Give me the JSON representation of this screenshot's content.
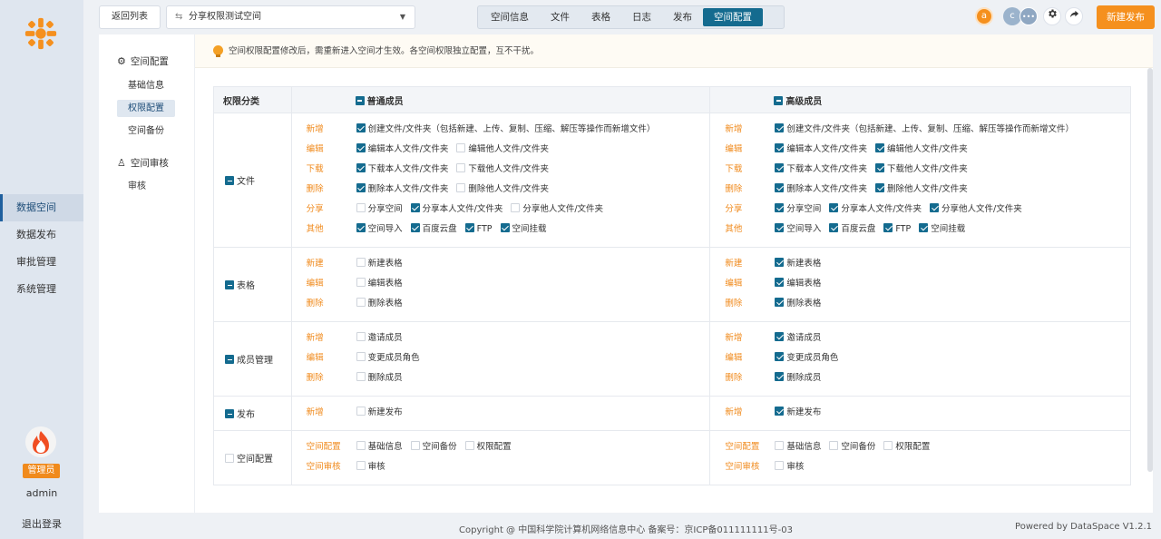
{
  "sidebar": {
    "items": [
      {
        "label": "数据空间",
        "active": true
      },
      {
        "label": "数据发布",
        "active": false
      },
      {
        "label": "审批管理",
        "active": false
      },
      {
        "label": "系统管理",
        "active": false
      }
    ],
    "role": "管理员",
    "username": "admin",
    "logout": "退出登录"
  },
  "topbar": {
    "back": "返回列表",
    "space": "分享权限测试空间",
    "tabs": [
      {
        "label": "空间信息",
        "active": false
      },
      {
        "label": "文件",
        "active": false
      },
      {
        "label": "表格",
        "active": false
      },
      {
        "label": "日志",
        "active": false
      },
      {
        "label": "发布",
        "active": false
      },
      {
        "label": "空间配置",
        "active": true
      }
    ],
    "avatars": [
      {
        "letter": "a",
        "color": "#f5901e"
      },
      {
        "letter": "c",
        "color": "#9bb3cc"
      },
      {
        "letter": "•••",
        "color": "#8fa7c2"
      }
    ],
    "publish": "新建发布"
  },
  "subnav": {
    "config_head": "空间配置",
    "config_items": [
      {
        "label": "基础信息",
        "active": false
      },
      {
        "label": "权限配置",
        "active": true
      },
      {
        "label": "空间备份",
        "active": false
      }
    ],
    "audit_head": "空间审核",
    "audit_items": [
      {
        "label": "审核",
        "active": false
      }
    ]
  },
  "notice": "空间权限配置修改后，需重新进入空间才生效。各空间权限独立配置，互不干扰。",
  "table": {
    "header": {
      "category": "权限分类",
      "ordinary": "普通成员",
      "advanced": "高级成员"
    },
    "sections": [
      {
        "category": "文件",
        "cat_state": "ind",
        "rows": [
          {
            "action": "新增",
            "ordinary": [
              {
                "label": "创建文件/文件夹（包括新建、上传、复制、压缩、解压等操作而新增文件）",
                "checked": true
              }
            ],
            "advanced": [
              {
                "label": "创建文件/文件夹（包括新建、上传、复制、压缩、解压等操作而新增文件）",
                "checked": true
              }
            ]
          },
          {
            "action": "编辑",
            "ordinary": [
              {
                "label": "编辑本人文件/文件夹",
                "checked": true
              },
              {
                "label": "编辑他人文件/文件夹",
                "checked": false
              }
            ],
            "advanced": [
              {
                "label": "编辑本人文件/文件夹",
                "checked": true
              },
              {
                "label": "编辑他人文件/文件夹",
                "checked": true
              }
            ]
          },
          {
            "action": "下载",
            "ordinary": [
              {
                "label": "下载本人文件/文件夹",
                "checked": true
              },
              {
                "label": "下载他人文件/文件夹",
                "checked": false
              }
            ],
            "advanced": [
              {
                "label": "下载本人文件/文件夹",
                "checked": true
              },
              {
                "label": "下载他人文件/文件夹",
                "checked": true
              }
            ]
          },
          {
            "action": "删除",
            "ordinary": [
              {
                "label": "删除本人文件/文件夹",
                "checked": true
              },
              {
                "label": "删除他人文件/文件夹",
                "checked": false
              }
            ],
            "advanced": [
              {
                "label": "删除本人文件/文件夹",
                "checked": true
              },
              {
                "label": "删除他人文件/文件夹",
                "checked": true
              }
            ]
          },
          {
            "action": "分享",
            "ordinary": [
              {
                "label": "分享空间",
                "checked": false
              },
              {
                "label": "分享本人文件/文件夹",
                "checked": true
              },
              {
                "label": "分享他人文件/文件夹",
                "checked": false
              }
            ],
            "advanced": [
              {
                "label": "分享空间",
                "checked": true
              },
              {
                "label": "分享本人文件/文件夹",
                "checked": true
              },
              {
                "label": "分享他人文件/文件夹",
                "checked": true
              }
            ]
          },
          {
            "action": "其他",
            "ordinary": [
              {
                "label": "空间导入",
                "checked": true
              },
              {
                "label": "百度云盘",
                "checked": true
              },
              {
                "label": "FTP",
                "checked": true
              },
              {
                "label": "空间挂载",
                "checked": true
              }
            ],
            "advanced": [
              {
                "label": "空间导入",
                "checked": true
              },
              {
                "label": "百度云盘",
                "checked": true
              },
              {
                "label": "FTP",
                "checked": true
              },
              {
                "label": "空间挂载",
                "checked": true
              }
            ]
          }
        ]
      },
      {
        "category": "表格",
        "cat_state": "ind",
        "rows": [
          {
            "action": "新建",
            "ordinary": [
              {
                "label": "新建表格",
                "checked": false
              }
            ],
            "advanced": [
              {
                "label": "新建表格",
                "checked": true
              }
            ]
          },
          {
            "action": "编辑",
            "ordinary": [
              {
                "label": "编辑表格",
                "checked": false
              }
            ],
            "advanced": [
              {
                "label": "编辑表格",
                "checked": true
              }
            ]
          },
          {
            "action": "删除",
            "ordinary": [
              {
                "label": "删除表格",
                "checked": false
              }
            ],
            "advanced": [
              {
                "label": "删除表格",
                "checked": true
              }
            ]
          }
        ]
      },
      {
        "category": "成员管理",
        "cat_state": "ind",
        "rows": [
          {
            "action": "新增",
            "ordinary": [
              {
                "label": "邀请成员",
                "checked": false
              }
            ],
            "advanced": [
              {
                "label": "邀请成员",
                "checked": true
              }
            ]
          },
          {
            "action": "编辑",
            "ordinary": [
              {
                "label": "变更成员角色",
                "checked": false
              }
            ],
            "advanced": [
              {
                "label": "变更成员角色",
                "checked": true
              }
            ]
          },
          {
            "action": "删除",
            "ordinary": [
              {
                "label": "删除成员",
                "checked": false
              }
            ],
            "advanced": [
              {
                "label": "删除成员",
                "checked": true
              }
            ]
          }
        ]
      },
      {
        "category": "发布",
        "cat_state": "ind",
        "rows": [
          {
            "action": "新增",
            "ordinary": [
              {
                "label": "新建发布",
                "checked": false
              }
            ],
            "advanced": [
              {
                "label": "新建发布",
                "checked": true
              }
            ]
          }
        ]
      },
      {
        "category": "空间配置",
        "cat_state": "off",
        "rows": [
          {
            "action": "空间配置",
            "ordinary": [
              {
                "label": "基础信息",
                "checked": false
              },
              {
                "label": "空间备份",
                "checked": false
              },
              {
                "label": "权限配置",
                "checked": false
              }
            ],
            "advanced": [
              {
                "label": "基础信息",
                "checked": false
              },
              {
                "label": "空间备份",
                "checked": false
              },
              {
                "label": "权限配置",
                "checked": false
              }
            ]
          },
          {
            "action": "空间审核",
            "ordinary": [
              {
                "label": "审核",
                "checked": false
              }
            ],
            "advanced": [
              {
                "label": "审核",
                "checked": false
              }
            ]
          }
        ]
      }
    ]
  },
  "footer": {
    "copyright": "Copyright @ 中国科学院计算机网络信息中心 备案号：京ICP备011111111号-03",
    "powered": "Powered by DataSpace V1.2.1"
  }
}
